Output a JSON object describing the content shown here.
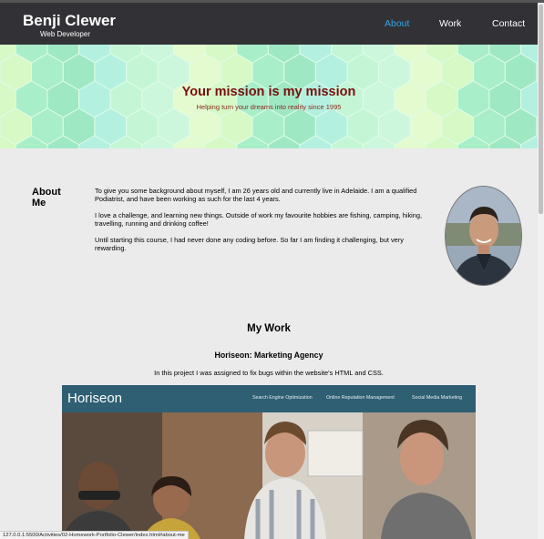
{
  "header": {
    "brand_name": "Benji Clewer",
    "brand_subtitle": "Web Developer",
    "nav": [
      {
        "label": "About",
        "active": true
      },
      {
        "label": "Work",
        "active": false
      },
      {
        "label": "Contact",
        "active": false
      }
    ]
  },
  "hero": {
    "title": "Your mission is my mission",
    "subtitle": "Helping turn your dreams into reality since 1995"
  },
  "about": {
    "heading": "About Me",
    "paragraphs": [
      "To give you some background about myself, I am 26 years old and currently live in Adelaide. I am a qualified Podiatrist, and have been working as such for the last 4 years.",
      "I love a challenge, and learning new things. Outside of work my favourite hobbies are fishing, camping, hiking, travelling, running and drinking coffee!",
      "Until starting this course, I had never done any coding before. So far I am finding it challenging, but very rewarding."
    ]
  },
  "work": {
    "heading": "My Work",
    "project": {
      "title": "Horiseon: Marketing Agency",
      "description": "In this project I was assigned to fix bugs within the website's HTML and CSS.",
      "screenshot": {
        "logo": "Horiseon",
        "nav": [
          "Search Engine Optimization",
          "Online Reputation Management",
          "Social Media Marketing"
        ]
      }
    }
  },
  "status_bar": {
    "url": "127.0.0.1:5500/Activities/02-Homework-Portfolio-Clewer/index.html#about-me"
  },
  "colors": {
    "header_bg": "#323236",
    "nav_active": "#33a3e2",
    "hero_title": "#7a0f0f",
    "page_bg": "#ebebeb",
    "horiseon_bar": "#2e5f73"
  }
}
